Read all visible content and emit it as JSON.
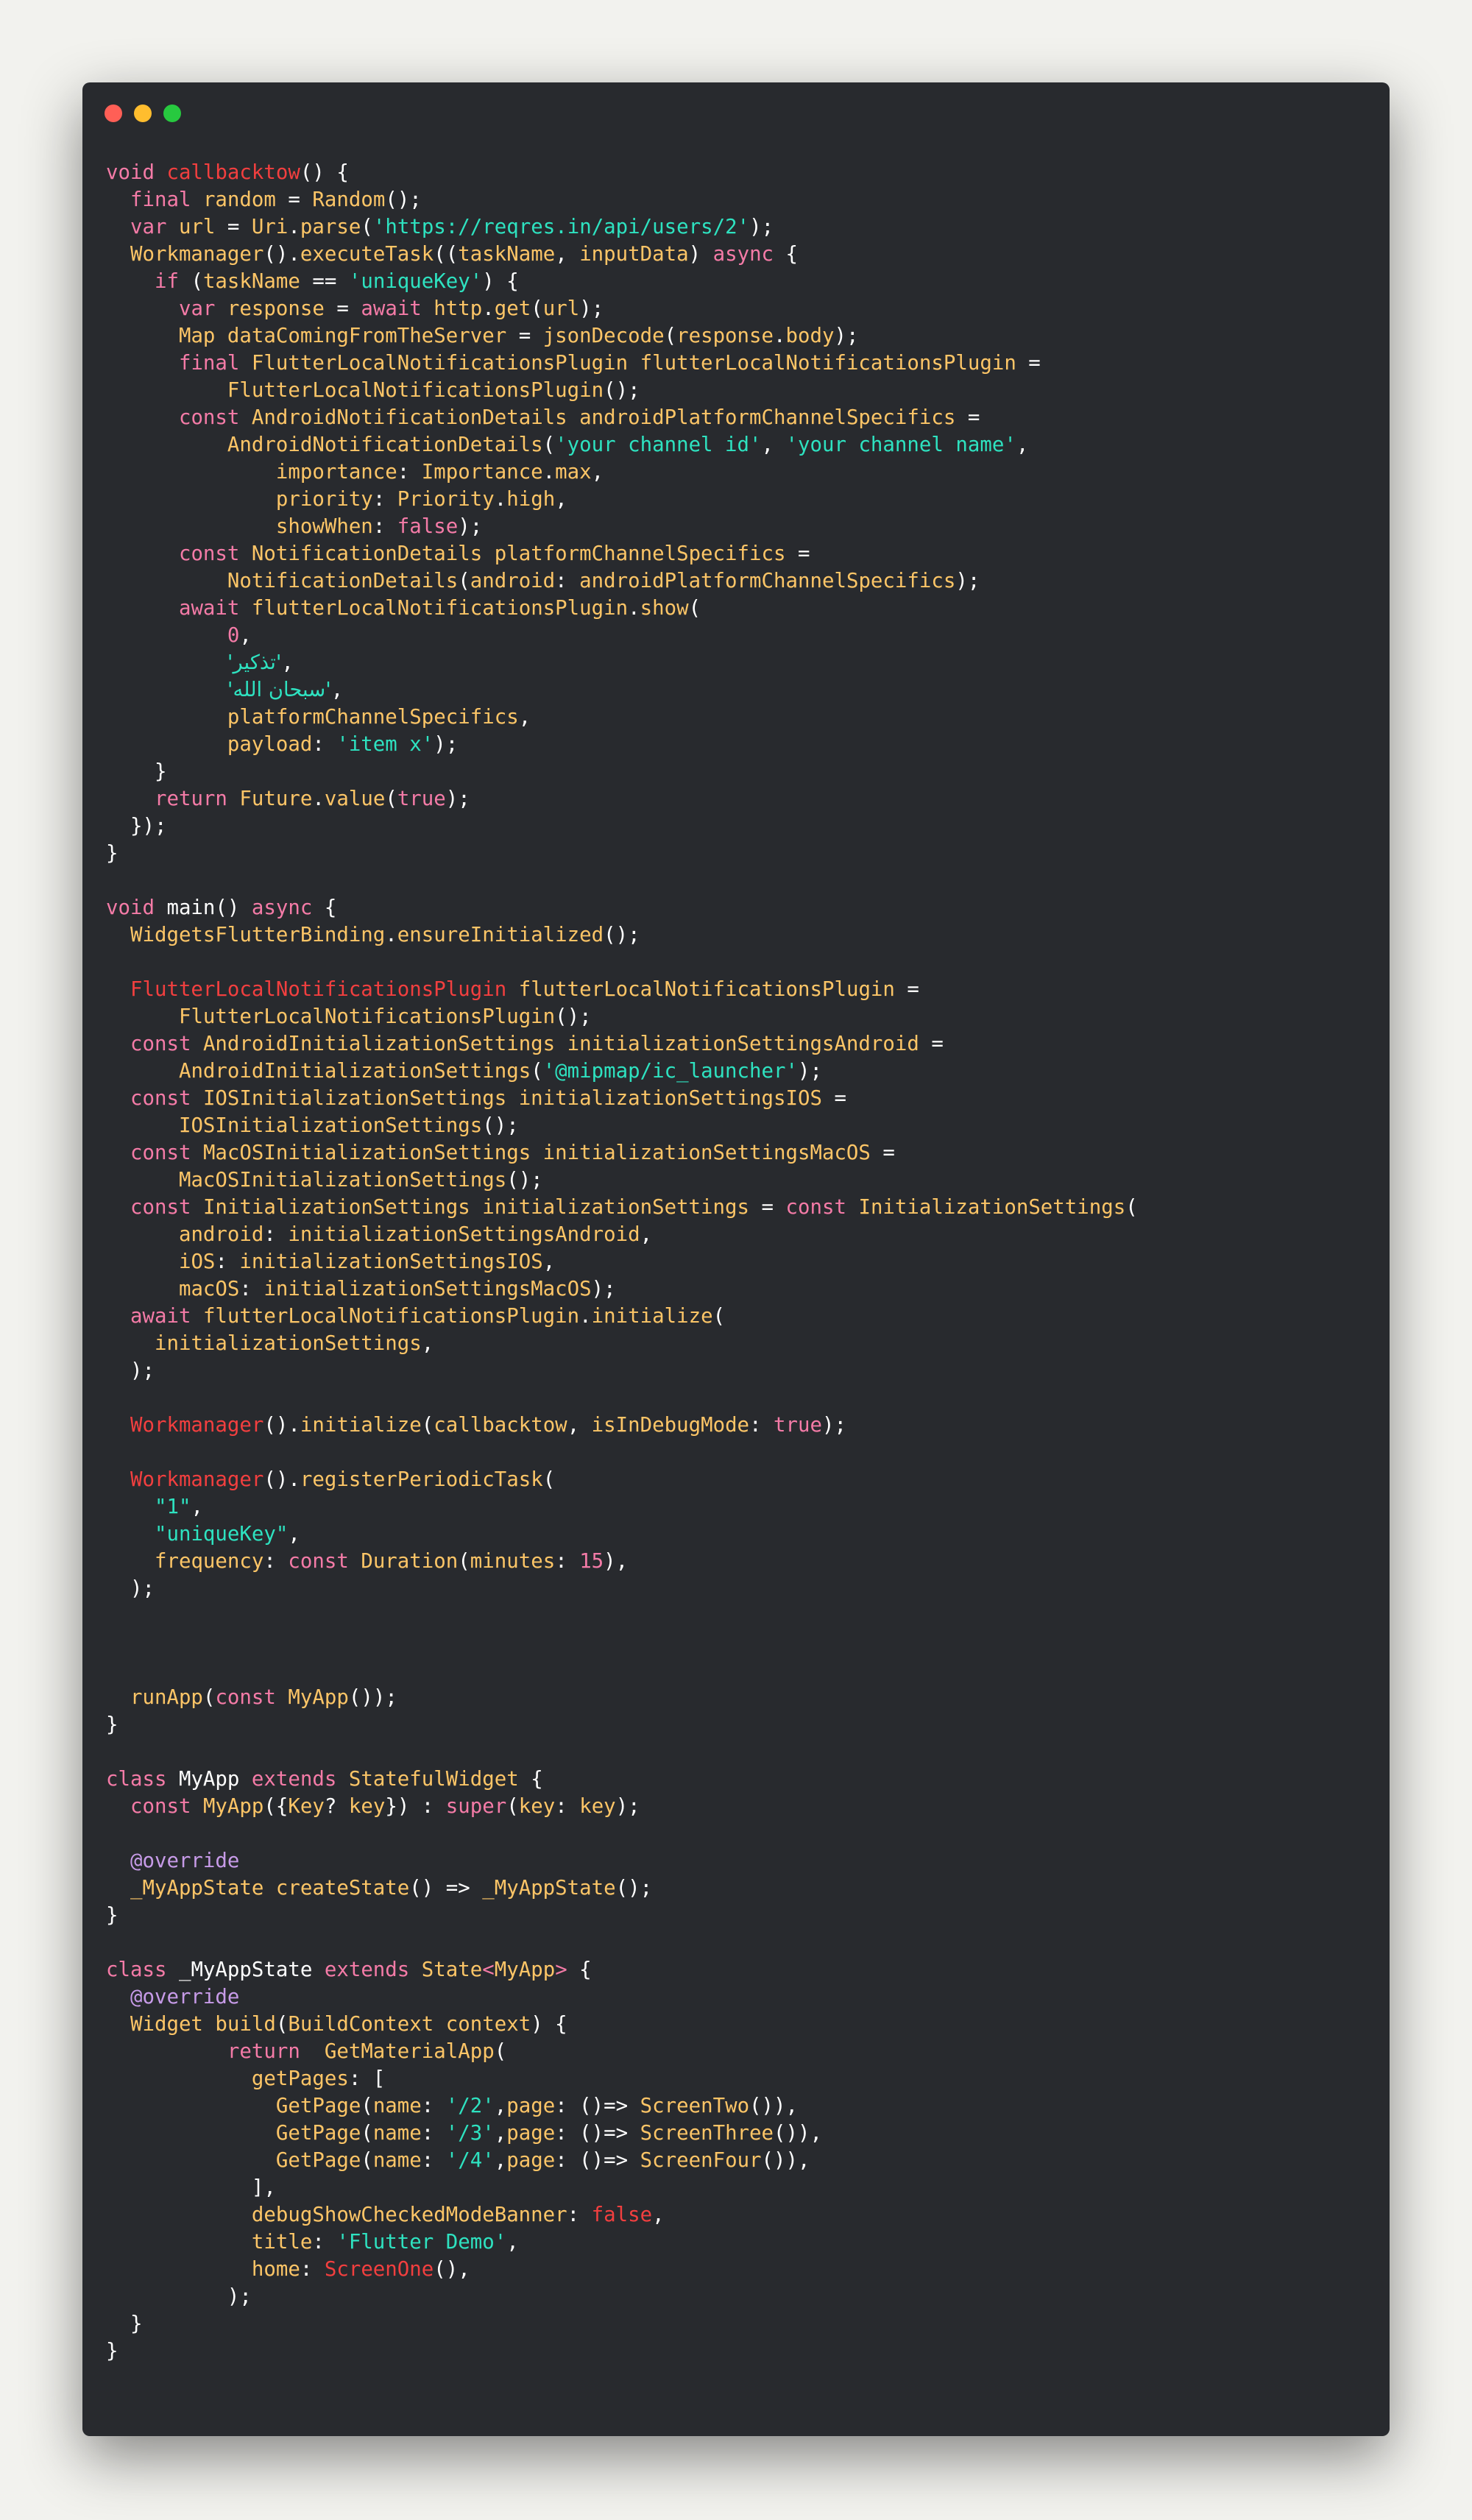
{
  "window": {
    "background": "#282a2e",
    "page_background": "#f2f2ee",
    "traffic_lights": [
      {
        "name": "close-button",
        "color": "#ff5f56"
      },
      {
        "name": "minimize-button",
        "color": "#ffbd2e"
      },
      {
        "name": "maximize-button",
        "color": "#27c93f"
      }
    ]
  },
  "theme": {
    "kw": "#f47ba7",
    "fn": "#fcc567",
    "str": "#2ee2c0",
    "red": "#f23f3f",
    "ann": "#c79be8",
    "id": "#ffffff"
  },
  "code_lines": [
    [
      [
        "kw",
        "void "
      ],
      [
        "red",
        "callbacktow"
      ],
      [
        "id",
        "() {"
      ]
    ],
    [
      [
        "id",
        "  "
      ],
      [
        "kw",
        "final "
      ],
      [
        "fn",
        "random"
      ],
      [
        "id",
        " = "
      ],
      [
        "fn",
        "Random"
      ],
      [
        "id",
        "();"
      ]
    ],
    [
      [
        "id",
        "  "
      ],
      [
        "kw",
        "var "
      ],
      [
        "fn",
        "url"
      ],
      [
        "id",
        " = "
      ],
      [
        "fn",
        "Uri"
      ],
      [
        "id",
        "."
      ],
      [
        "fn",
        "parse"
      ],
      [
        "id",
        "("
      ],
      [
        "str",
        "'https://reqres.in/api/users/2'"
      ],
      [
        "id",
        ");"
      ]
    ],
    [
      [
        "id",
        "  "
      ],
      [
        "fn",
        "Workmanager"
      ],
      [
        "id",
        "()."
      ],
      [
        "fn",
        "executeTask"
      ],
      [
        "id",
        "(("
      ],
      [
        "fn",
        "taskName"
      ],
      [
        "id",
        ", "
      ],
      [
        "fn",
        "inputData"
      ],
      [
        "id",
        ") "
      ],
      [
        "kw",
        "async"
      ],
      [
        "id",
        " {"
      ]
    ],
    [
      [
        "id",
        "    "
      ],
      [
        "kw",
        "if"
      ],
      [
        "id",
        " ("
      ],
      [
        "fn",
        "taskName"
      ],
      [
        "id",
        " == "
      ],
      [
        "str",
        "'uniqueKey'"
      ],
      [
        "id",
        ") {"
      ]
    ],
    [
      [
        "id",
        "      "
      ],
      [
        "kw",
        "var "
      ],
      [
        "fn",
        "response"
      ],
      [
        "id",
        " = "
      ],
      [
        "kw",
        "await "
      ],
      [
        "fn",
        "http"
      ],
      [
        "id",
        "."
      ],
      [
        "fn",
        "get"
      ],
      [
        "id",
        "("
      ],
      [
        "fn",
        "url"
      ],
      [
        "id",
        ");"
      ]
    ],
    [
      [
        "id",
        "      "
      ],
      [
        "fn",
        "Map dataComingFromTheServer"
      ],
      [
        "id",
        " = "
      ],
      [
        "fn",
        "jsonDecode"
      ],
      [
        "id",
        "("
      ],
      [
        "fn",
        "response"
      ],
      [
        "id",
        "."
      ],
      [
        "fn",
        "body"
      ],
      [
        "id",
        ");"
      ]
    ],
    [
      [
        "id",
        "      "
      ],
      [
        "kw",
        "final "
      ],
      [
        "fn",
        "FlutterLocalNotificationsPlugin flutterLocalNotificationsPlugin"
      ],
      [
        "id",
        " ="
      ]
    ],
    [
      [
        "id",
        "          "
      ],
      [
        "fn",
        "FlutterLocalNotificationsPlugin"
      ],
      [
        "id",
        "();"
      ]
    ],
    [
      [
        "id",
        "      "
      ],
      [
        "kw",
        "const "
      ],
      [
        "fn",
        "AndroidNotificationDetails androidPlatformChannelSpecifics"
      ],
      [
        "id",
        " ="
      ]
    ],
    [
      [
        "id",
        "          "
      ],
      [
        "fn",
        "AndroidNotificationDetails"
      ],
      [
        "id",
        "("
      ],
      [
        "str",
        "'your channel id'"
      ],
      [
        "id",
        ", "
      ],
      [
        "str",
        "'your channel name'"
      ],
      [
        "id",
        ","
      ]
    ],
    [
      [
        "id",
        "              "
      ],
      [
        "fn",
        "importance"
      ],
      [
        "id",
        ": "
      ],
      [
        "fn",
        "Importance"
      ],
      [
        "id",
        "."
      ],
      [
        "fn",
        "max"
      ],
      [
        "id",
        ","
      ]
    ],
    [
      [
        "id",
        "              "
      ],
      [
        "fn",
        "priority"
      ],
      [
        "id",
        ": "
      ],
      [
        "fn",
        "Priority"
      ],
      [
        "id",
        "."
      ],
      [
        "fn",
        "high"
      ],
      [
        "id",
        ","
      ]
    ],
    [
      [
        "id",
        "              "
      ],
      [
        "fn",
        "showWhen"
      ],
      [
        "id",
        ": "
      ],
      [
        "kw",
        "false"
      ],
      [
        "id",
        ");"
      ]
    ],
    [
      [
        "id",
        "      "
      ],
      [
        "kw",
        "const "
      ],
      [
        "fn",
        "NotificationDetails platformChannelSpecifics"
      ],
      [
        "id",
        " ="
      ]
    ],
    [
      [
        "id",
        "          "
      ],
      [
        "fn",
        "NotificationDetails"
      ],
      [
        "id",
        "("
      ],
      [
        "fn",
        "android"
      ],
      [
        "id",
        ": "
      ],
      [
        "fn",
        "androidPlatformChannelSpecifics"
      ],
      [
        "id",
        ");"
      ]
    ],
    [
      [
        "id",
        "      "
      ],
      [
        "kw",
        "await "
      ],
      [
        "fn",
        "flutterLocalNotificationsPlugin"
      ],
      [
        "id",
        "."
      ],
      [
        "fn",
        "show"
      ],
      [
        "id",
        "("
      ]
    ],
    [
      [
        "id",
        "          "
      ],
      [
        "kw",
        "0"
      ],
      [
        "id",
        ","
      ]
    ],
    [
      [
        "id",
        "          "
      ],
      [
        "str",
        "'تذكير'"
      ],
      [
        "id",
        ","
      ]
    ],
    [
      [
        "id",
        "          "
      ],
      [
        "str",
        "'سبحان الله'"
      ],
      [
        "id",
        ","
      ]
    ],
    [
      [
        "id",
        "          "
      ],
      [
        "fn",
        "platformChannelSpecifics"
      ],
      [
        "id",
        ","
      ]
    ],
    [
      [
        "id",
        "          "
      ],
      [
        "fn",
        "payload"
      ],
      [
        "id",
        ": "
      ],
      [
        "str",
        "'item x'"
      ],
      [
        "id",
        ");"
      ]
    ],
    [
      [
        "id",
        "    }"
      ]
    ],
    [
      [
        "id",
        "    "
      ],
      [
        "kw",
        "return "
      ],
      [
        "fn",
        "Future"
      ],
      [
        "id",
        "."
      ],
      [
        "fn",
        "value"
      ],
      [
        "id",
        "("
      ],
      [
        "kw",
        "true"
      ],
      [
        "id",
        ");"
      ]
    ],
    [
      [
        "id",
        "  });"
      ]
    ],
    [
      [
        "id",
        "}"
      ]
    ],
    [],
    [
      [
        "kw",
        "void "
      ],
      [
        "id",
        "main() "
      ],
      [
        "kw",
        "async"
      ],
      [
        "id",
        " {"
      ]
    ],
    [
      [
        "id",
        "  "
      ],
      [
        "fn",
        "WidgetsFlutterBinding"
      ],
      [
        "id",
        "."
      ],
      [
        "fn",
        "ensureInitialized"
      ],
      [
        "id",
        "();"
      ]
    ],
    [],
    [
      [
        "id",
        "  "
      ],
      [
        "red",
        "FlutterLocalNotificationsPlugin"
      ],
      [
        "id",
        " "
      ],
      [
        "fn",
        "flutterLocalNotificationsPlugin"
      ],
      [
        "id",
        " ="
      ]
    ],
    [
      [
        "id",
        "      "
      ],
      [
        "fn",
        "FlutterLocalNotificationsPlugin"
      ],
      [
        "id",
        "();"
      ]
    ],
    [
      [
        "id",
        "  "
      ],
      [
        "kw",
        "const "
      ],
      [
        "fn",
        "AndroidInitializationSettings initializationSettingsAndroid"
      ],
      [
        "id",
        " ="
      ]
    ],
    [
      [
        "id",
        "      "
      ],
      [
        "fn",
        "AndroidInitializationSettings"
      ],
      [
        "id",
        "("
      ],
      [
        "str",
        "'@mipmap/ic_launcher'"
      ],
      [
        "id",
        ");"
      ]
    ],
    [
      [
        "id",
        "  "
      ],
      [
        "kw",
        "const "
      ],
      [
        "fn",
        "IOSInitializationSettings initializationSettingsIOS"
      ],
      [
        "id",
        " ="
      ]
    ],
    [
      [
        "id",
        "      "
      ],
      [
        "fn",
        "IOSInitializationSettings"
      ],
      [
        "id",
        "();"
      ]
    ],
    [
      [
        "id",
        "  "
      ],
      [
        "kw",
        "const "
      ],
      [
        "fn",
        "MacOSInitializationSettings initializationSettingsMacOS"
      ],
      [
        "id",
        " ="
      ]
    ],
    [
      [
        "id",
        "      "
      ],
      [
        "fn",
        "MacOSInitializationSettings"
      ],
      [
        "id",
        "();"
      ]
    ],
    [
      [
        "id",
        "  "
      ],
      [
        "kw",
        "const "
      ],
      [
        "fn",
        "InitializationSettings initializationSettings"
      ],
      [
        "id",
        " = "
      ],
      [
        "kw",
        "const "
      ],
      [
        "fn",
        "InitializationSettings"
      ],
      [
        "id",
        "("
      ]
    ],
    [
      [
        "id",
        "      "
      ],
      [
        "fn",
        "android"
      ],
      [
        "id",
        ": "
      ],
      [
        "fn",
        "initializationSettingsAndroid"
      ],
      [
        "id",
        ","
      ]
    ],
    [
      [
        "id",
        "      "
      ],
      [
        "fn",
        "iOS"
      ],
      [
        "id",
        ": "
      ],
      [
        "fn",
        "initializationSettingsIOS"
      ],
      [
        "id",
        ","
      ]
    ],
    [
      [
        "id",
        "      "
      ],
      [
        "fn",
        "macOS"
      ],
      [
        "id",
        ": "
      ],
      [
        "fn",
        "initializationSettingsMacOS"
      ],
      [
        "id",
        ");"
      ]
    ],
    [
      [
        "id",
        "  "
      ],
      [
        "kw",
        "await "
      ],
      [
        "fn",
        "flutterLocalNotificationsPlugin"
      ],
      [
        "id",
        "."
      ],
      [
        "fn",
        "initialize"
      ],
      [
        "id",
        "("
      ]
    ],
    [
      [
        "id",
        "    "
      ],
      [
        "fn",
        "initializationSettings"
      ],
      [
        "id",
        ","
      ]
    ],
    [
      [
        "id",
        "  );"
      ]
    ],
    [],
    [
      [
        "id",
        "  "
      ],
      [
        "red",
        "Workmanager"
      ],
      [
        "id",
        "()."
      ],
      [
        "fn",
        "initialize"
      ],
      [
        "id",
        "("
      ],
      [
        "fn",
        "callbacktow"
      ],
      [
        "id",
        ", "
      ],
      [
        "fn",
        "isInDebugMode"
      ],
      [
        "id",
        ": "
      ],
      [
        "kw",
        "true"
      ],
      [
        "id",
        ");"
      ]
    ],
    [],
    [
      [
        "id",
        "  "
      ],
      [
        "red",
        "Workmanager"
      ],
      [
        "id",
        "()."
      ],
      [
        "fn",
        "registerPeriodicTask"
      ],
      [
        "id",
        "("
      ]
    ],
    [
      [
        "id",
        "    "
      ],
      [
        "str",
        "\"1\""
      ],
      [
        "id",
        ","
      ]
    ],
    [
      [
        "id",
        "    "
      ],
      [
        "str",
        "\"uniqueKey\""
      ],
      [
        "id",
        ","
      ]
    ],
    [
      [
        "id",
        "    "
      ],
      [
        "fn",
        "frequency"
      ],
      [
        "id",
        ": "
      ],
      [
        "kw",
        "const "
      ],
      [
        "fn",
        "Duration"
      ],
      [
        "id",
        "("
      ],
      [
        "fn",
        "minutes"
      ],
      [
        "id",
        ": "
      ],
      [
        "kw",
        "15"
      ],
      [
        "id",
        "),"
      ]
    ],
    [
      [
        "id",
        "  );"
      ]
    ],
    [],
    [],
    [],
    [
      [
        "id",
        "  "
      ],
      [
        "fn",
        "runApp"
      ],
      [
        "id",
        "("
      ],
      [
        "kw",
        "const "
      ],
      [
        "fn",
        "MyApp"
      ],
      [
        "id",
        "());"
      ]
    ],
    [
      [
        "id",
        "}"
      ]
    ],
    [],
    [
      [
        "kw",
        "class "
      ],
      [
        "id",
        "MyApp "
      ],
      [
        "kw",
        "extends "
      ],
      [
        "fn",
        "StatefulWidget"
      ],
      [
        "id",
        " {"
      ]
    ],
    [
      [
        "id",
        "  "
      ],
      [
        "kw",
        "const "
      ],
      [
        "fn",
        "MyApp"
      ],
      [
        "id",
        "({"
      ],
      [
        "fn",
        "Key"
      ],
      [
        "id",
        "? "
      ],
      [
        "fn",
        "key"
      ],
      [
        "id",
        "}) : "
      ],
      [
        "kw",
        "super"
      ],
      [
        "id",
        "("
      ],
      [
        "fn",
        "key"
      ],
      [
        "id",
        ": "
      ],
      [
        "fn",
        "key"
      ],
      [
        "id",
        ");"
      ]
    ],
    [],
    [
      [
        "id",
        "  "
      ],
      [
        "ann",
        "@override"
      ]
    ],
    [
      [
        "id",
        "  "
      ],
      [
        "fn",
        "_MyAppState createState"
      ],
      [
        "id",
        "() => "
      ],
      [
        "fn",
        "_MyAppState"
      ],
      [
        "id",
        "();"
      ]
    ],
    [
      [
        "id",
        "}"
      ]
    ],
    [],
    [
      [
        "kw",
        "class "
      ],
      [
        "id",
        "_MyAppState "
      ],
      [
        "kw",
        "extends "
      ],
      [
        "fn",
        "State"
      ],
      [
        "kw",
        "<"
      ],
      [
        "fn",
        "MyApp"
      ],
      [
        "kw",
        ">"
      ],
      [
        "id",
        " {"
      ]
    ],
    [
      [
        "id",
        "  "
      ],
      [
        "ann",
        "@override"
      ]
    ],
    [
      [
        "id",
        "  "
      ],
      [
        "fn",
        "Widget build"
      ],
      [
        "id",
        "("
      ],
      [
        "fn",
        "BuildContext context"
      ],
      [
        "id",
        ") {"
      ]
    ],
    [
      [
        "id",
        "          "
      ],
      [
        "kw",
        "return  "
      ],
      [
        "fn",
        "GetMaterialApp"
      ],
      [
        "id",
        "("
      ]
    ],
    [
      [
        "id",
        "            "
      ],
      [
        "fn",
        "getPages"
      ],
      [
        "id",
        ": ["
      ]
    ],
    [
      [
        "id",
        "              "
      ],
      [
        "fn",
        "GetPage"
      ],
      [
        "id",
        "("
      ],
      [
        "fn",
        "name"
      ],
      [
        "id",
        ": "
      ],
      [
        "str",
        "'/2'"
      ],
      [
        "id",
        ","
      ],
      [
        "fn",
        "page"
      ],
      [
        "id",
        ": ()=> "
      ],
      [
        "fn",
        "ScreenTwo"
      ],
      [
        "id",
        "()),"
      ]
    ],
    [
      [
        "id",
        "              "
      ],
      [
        "fn",
        "GetPage"
      ],
      [
        "id",
        "("
      ],
      [
        "fn",
        "name"
      ],
      [
        "id",
        ": "
      ],
      [
        "str",
        "'/3'"
      ],
      [
        "id",
        ","
      ],
      [
        "fn",
        "page"
      ],
      [
        "id",
        ": ()=> "
      ],
      [
        "fn",
        "ScreenThree"
      ],
      [
        "id",
        "()),"
      ]
    ],
    [
      [
        "id",
        "              "
      ],
      [
        "fn",
        "GetPage"
      ],
      [
        "id",
        "("
      ],
      [
        "fn",
        "name"
      ],
      [
        "id",
        ": "
      ],
      [
        "str",
        "'/4'"
      ],
      [
        "id",
        ","
      ],
      [
        "fn",
        "page"
      ],
      [
        "id",
        ": ()=> "
      ],
      [
        "fn",
        "ScreenFour"
      ],
      [
        "id",
        "()),"
      ]
    ],
    [
      [
        "id",
        "            ],"
      ]
    ],
    [
      [
        "id",
        "            "
      ],
      [
        "fn",
        "debugShowCheckedModeBanner"
      ],
      [
        "id",
        ": "
      ],
      [
        "red",
        "false"
      ],
      [
        "id",
        ","
      ]
    ],
    [
      [
        "id",
        "            "
      ],
      [
        "fn",
        "title"
      ],
      [
        "id",
        ": "
      ],
      [
        "str",
        "'Flutter Demo'"
      ],
      [
        "id",
        ","
      ]
    ],
    [
      [
        "id",
        "            "
      ],
      [
        "fn",
        "home"
      ],
      [
        "id",
        ": "
      ],
      [
        "red",
        "ScreenOne"
      ],
      [
        "id",
        "(),"
      ]
    ],
    [
      [
        "id",
        "          );"
      ]
    ],
    [
      [
        "id",
        "  }"
      ]
    ],
    [
      [
        "id",
        "}"
      ]
    ]
  ]
}
